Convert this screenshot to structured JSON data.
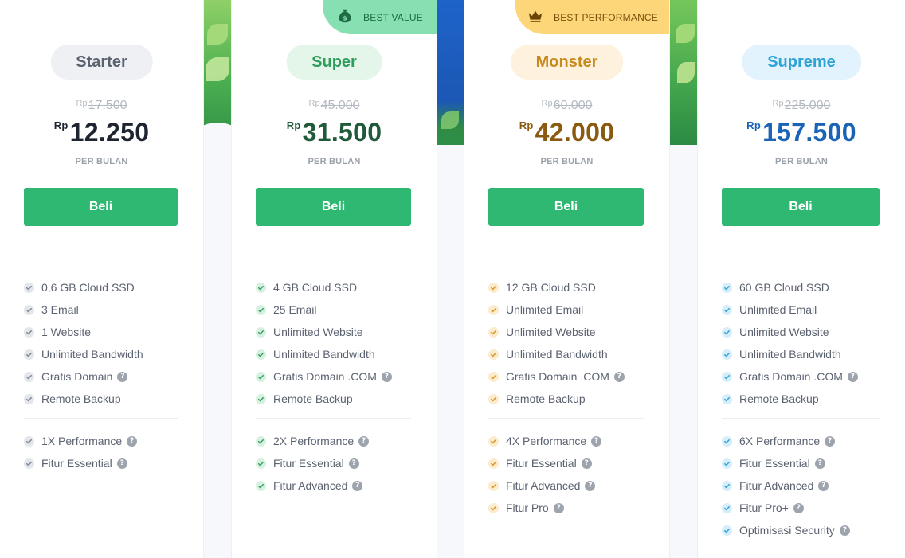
{
  "currency": "Rp",
  "period_label": "PER BULAN",
  "buy_label": "Beli",
  "help_glyph": "?",
  "colors": {
    "buy_button": "#2eb872",
    "best_value_ribbon": "#86e0b1",
    "best_performance_ribbon": "#fcd679"
  },
  "plans": [
    {
      "name": "Starter",
      "old_price": "17.500",
      "price": "12.250",
      "accent": "#5a6270",
      "features": [
        "0,6 GB Cloud SSD",
        "3 Email",
        "1 Website",
        "Unlimited Bandwidth",
        "Gratis Domain",
        "Remote Backup"
      ],
      "extras": [
        "1X Performance",
        "Fitur Essential"
      ]
    },
    {
      "name": "Super",
      "badge": "BEST VALUE",
      "badge_icon": "money-bag-icon",
      "old_price": "45.000",
      "price": "31.500",
      "accent": "#2f9d5c",
      "features": [
        "4 GB Cloud SSD",
        "25 Email",
        "Unlimited Website",
        "Unlimited Bandwidth",
        "Gratis Domain .COM",
        "Remote Backup"
      ],
      "extras": [
        "2X Performance",
        "Fitur Essential",
        "Fitur Advanced"
      ]
    },
    {
      "name": "Monster",
      "badge": "BEST PERFORMANCE",
      "badge_icon": "crown-icon",
      "old_price": "60.000",
      "price": "42.000",
      "accent": "#c98a1d",
      "features": [
        "12 GB Cloud SSD",
        "Unlimited Email",
        "Unlimited Website",
        "Unlimited Bandwidth",
        "Gratis Domain .COM",
        "Remote Backup"
      ],
      "extras": [
        "4X Performance",
        "Fitur Essential",
        "Fitur Advanced",
        "Fitur Pro"
      ]
    },
    {
      "name": "Supreme",
      "old_price": "225.000",
      "price": "157.500",
      "accent": "#2ea3d6",
      "features": [
        "60 GB Cloud SSD",
        "Unlimited Email",
        "Unlimited Website",
        "Unlimited Bandwidth",
        "Gratis Domain .COM",
        "Remote Backup"
      ],
      "extras": [
        "6X Performance",
        "Fitur Essential",
        "Fitur Advanced",
        "Fitur Pro+",
        "Optimisasi Security"
      ]
    }
  ]
}
